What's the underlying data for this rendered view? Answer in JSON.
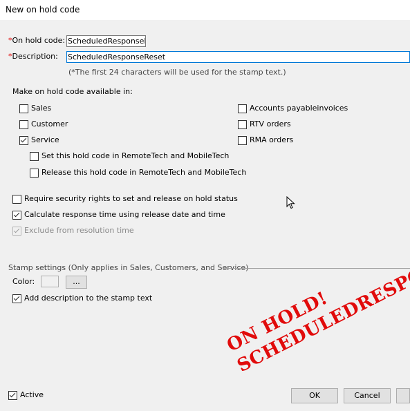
{
  "window": {
    "title": "New on hold code"
  },
  "fields": {
    "on_hold_code": {
      "asterisk": "*",
      "label": "On hold code:",
      "value": "ScheduledResponseRes"
    },
    "description": {
      "asterisk": "*",
      "label": "Description:",
      "value": "ScheduledResponseReset"
    },
    "hint": "(*The first 24 characters will be used for the stamp text.)"
  },
  "availability": {
    "heading": "Make on hold code available in:",
    "sales": {
      "label": "Sales",
      "checked": false
    },
    "customer": {
      "label": "Customer",
      "checked": false
    },
    "service": {
      "label": "Service",
      "checked": true
    },
    "set_remotetech": {
      "label": "Set this hold code in RemoteTech and MobileTech",
      "checked": false
    },
    "release_remotetech": {
      "label": "Release this hold code in RemoteTech and MobileTech",
      "checked": false
    },
    "ap_invoices": {
      "label": "Accounts payableinvoices",
      "checked": false
    },
    "rtv_orders": {
      "label": "RTV orders",
      "checked": false
    },
    "rma_orders": {
      "label": "RMA orders",
      "checked": false
    }
  },
  "options": {
    "security": {
      "label": "Require security rights to set and release on hold status",
      "checked": false
    },
    "response_time": {
      "label": "Calculate response time using release date and time",
      "checked": true
    },
    "exclude_resolution": {
      "label": "Exclude from resolution time",
      "checked": true,
      "disabled": true
    }
  },
  "stamp": {
    "section_label": "Stamp settings (Only applies in Sales, Customers, and Service)",
    "color_label": "Color:",
    "color_button": "...",
    "add_description": {
      "label": "Add description to the stamp text",
      "checked": true
    },
    "preview_line1": "ON HOLD!",
    "preview_line2": "SCHEDULEDRESPONSERESET",
    "preview_color": "#e10b0b"
  },
  "footer": {
    "active": {
      "label": "Active",
      "checked": true
    },
    "ok_label": "OK",
    "cancel_label": "Cancel"
  }
}
